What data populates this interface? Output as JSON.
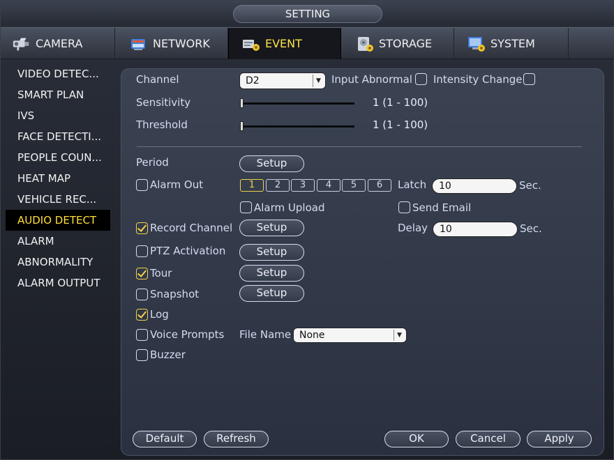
{
  "window": {
    "title": "SETTING"
  },
  "tabs": [
    {
      "label": "CAMERA"
    },
    {
      "label": "NETWORK"
    },
    {
      "label": "EVENT",
      "active": true
    },
    {
      "label": "STORAGE"
    },
    {
      "label": "SYSTEM"
    }
  ],
  "sidebar": {
    "items": [
      {
        "label": "VIDEO DETEC..."
      },
      {
        "label": "SMART PLAN"
      },
      {
        "label": "IVS"
      },
      {
        "label": "FACE DETECTI..."
      },
      {
        "label": "PEOPLE COUN..."
      },
      {
        "label": "HEAT MAP"
      },
      {
        "label": "VEHICLE REC..."
      },
      {
        "label": "AUDIO DETECT",
        "active": true
      },
      {
        "label": "ALARM"
      },
      {
        "label": "ABNORMALITY"
      },
      {
        "label": "ALARM OUTPUT"
      }
    ]
  },
  "form": {
    "channel_label": "Channel",
    "channel_value": "D2",
    "input_abnormal_label": "Input Abnormal",
    "input_abnormal_checked": false,
    "intensity_change_label": "Intensity Change",
    "intensity_change_checked": false,
    "sensitivity_label": "Sensitivity",
    "sensitivity_value": 1,
    "sensitivity_text": "1 (1 - 100)",
    "threshold_label": "Threshold",
    "threshold_value": 1,
    "threshold_text": "1 (1 - 100)",
    "period_label": "Period",
    "setup_label": "Setup",
    "alarm_out_label": "Alarm Out",
    "alarm_out_checked": false,
    "alarm_out_numbers": [
      "1",
      "2",
      "3",
      "4",
      "5",
      "6"
    ],
    "alarm_out_selected": "1",
    "latch_label": "Latch",
    "latch_value": "10",
    "sec_label": "Sec.",
    "alarm_upload_label": "Alarm Upload",
    "alarm_upload_checked": false,
    "send_email_label": "Send Email",
    "send_email_checked": false,
    "record_channel_label": "Record Channel",
    "record_channel_checked": true,
    "delay_label": "Delay",
    "delay_value": "10",
    "ptz_label": "PTZ Activation",
    "ptz_checked": false,
    "tour_label": "Tour",
    "tour_checked": true,
    "snapshot_label": "Snapshot",
    "snapshot_checked": false,
    "log_label": "Log",
    "log_checked": true,
    "voice_prompts_label": "Voice Prompts",
    "voice_prompts_checked": false,
    "file_name_label": "File Name",
    "file_name_value": "None",
    "buzzer_label": "Buzzer",
    "buzzer_checked": false
  },
  "footer": {
    "default_label": "Default",
    "refresh_label": "Refresh",
    "ok_label": "OK",
    "cancel_label": "Cancel",
    "apply_label": "Apply"
  },
  "icons": {
    "camera": "camera-icon",
    "network": "network-icon",
    "event": "event-icon",
    "storage": "storage-icon",
    "system": "system-icon"
  },
  "colors": {
    "active_accent": "#ffdf3a",
    "check_accent": "#f1d24a",
    "panel_bg": "#333a4a"
  }
}
